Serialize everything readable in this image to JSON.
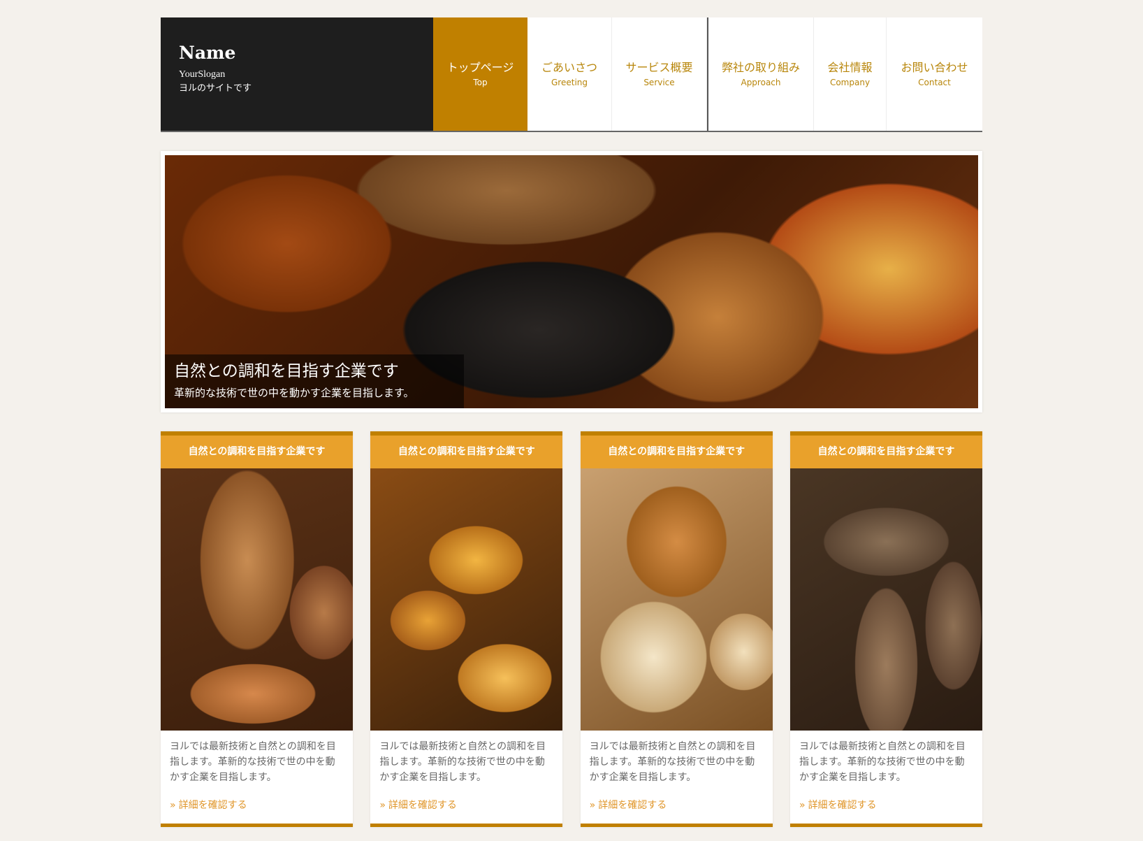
{
  "brand": {
    "name": "Name",
    "slogan": "YourSlogan",
    "sub": "ヨルのサイトです"
  },
  "nav": [
    {
      "jp": "トップページ",
      "en": "Top",
      "active": true
    },
    {
      "jp": "ごあいさつ",
      "en": "Greeting"
    },
    {
      "jp": "サービス概要",
      "en": "Service"
    },
    {
      "jp": "弊社の取り組み",
      "en": "Approach"
    },
    {
      "jp": "会社情報",
      "en": "Company"
    },
    {
      "jp": "お問い合わせ",
      "en": "Contact"
    }
  ],
  "hero": {
    "title": "自然との調和を目指す企業です",
    "desc": "革新的な技術で世の中を動かす企業を目指します。"
  },
  "cards": [
    {
      "title": "自然との調和を目指す企業です",
      "text": "ヨルでは最新技術と自然との調和を目指します。革新的な技術で世の中を動かす企業を目指します。",
      "link": "詳細を確認する",
      "image": "bread-baguette-sandwich"
    },
    {
      "title": "自然との調和を目指す企業です",
      "text": "ヨルでは最新技術と自然との調和を目指します。革新的な技術で世の中を動かす企業を目指します。",
      "link": "詳細を確認する",
      "image": "croissants"
    },
    {
      "title": "自然との調和を目指す企業です",
      "text": "ヨルでは最新技術と自然との調和を目指します。革新的な技術で世の中を動かす企業を目指します。",
      "link": "詳細を確認する",
      "image": "white-bread"
    },
    {
      "title": "自然との調和を目指す企業です",
      "text": "ヨルでは最新技術と自然との調和を目指します。革新的な技術で世の中を動かす企業を目指します。",
      "link": "詳細を確認する",
      "image": "whole-grain-bread"
    }
  ],
  "link_arrow": "»",
  "colors": {
    "accent": "#c08000",
    "card_header": "#e9a12b",
    "link": "#e0962a",
    "brand_bg": "#1e1e1e",
    "page_bg": "#f4f1ec"
  }
}
